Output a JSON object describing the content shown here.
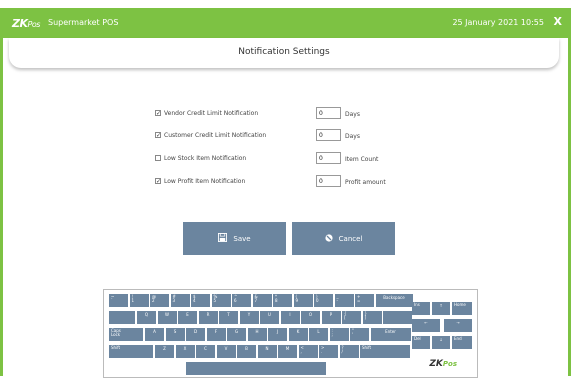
{
  "appbar": {
    "logo": "ZK",
    "logo_suffix": "Pos",
    "app_name": "Supermarket POS",
    "datetime": "25 January 2021 10:55",
    "close_label": "X"
  },
  "title": "Notification Settings",
  "settings": [
    {
      "label": "Vendor Credit Limit Notification",
      "checked": true,
      "value": "0",
      "unit": "Days"
    },
    {
      "label": "Customer Credit Limit Notification",
      "checked": true,
      "value": "0",
      "unit": "Days"
    },
    {
      "label": "Low Stock Item Notification",
      "checked": false,
      "value": "0",
      "unit": "Item Count"
    },
    {
      "label": "Low Profit Item Notification",
      "checked": true,
      "value": "0",
      "unit": "Profit amount"
    }
  ],
  "buttons": {
    "save": "Save",
    "cancel": "Cancel"
  },
  "keyboard": {
    "row1": [
      "~\n`",
      "!\n1",
      "@\n2",
      "#\n3",
      "$\n4",
      "%\n5",
      "^\n6",
      "&\n7",
      "*\n8",
      "(\n9",
      ")\n0",
      "_\n-",
      "+\n="
    ],
    "backspace": "Backspace",
    "row2": [
      "Q",
      "W",
      "E",
      "R",
      "T",
      "Y",
      "U",
      "I",
      "O",
      "P",
      "{\n[",
      "}\n]"
    ],
    "row3_left": "Caps\nLock",
    "row3": [
      "A",
      "S",
      "D",
      "F",
      "G",
      "H",
      "J",
      "K",
      "L",
      ":\n;",
      "\"\n'"
    ],
    "enter": "Enter",
    "shift_left": "Shift",
    "row4": [
      "Z",
      "X",
      "C",
      "V",
      "B",
      "N",
      "M",
      "<\n,",
      ">\n.",
      "?\n/"
    ],
    "shift_right": "Shift",
    "nav": {
      "ins": "Ins",
      "up": "↑",
      "home": "Home",
      "left": "←",
      "right": "→",
      "del": "Del",
      "down": "↓",
      "end": "End"
    },
    "brand": "ZK",
    "brand_suffix": "Pos"
  }
}
